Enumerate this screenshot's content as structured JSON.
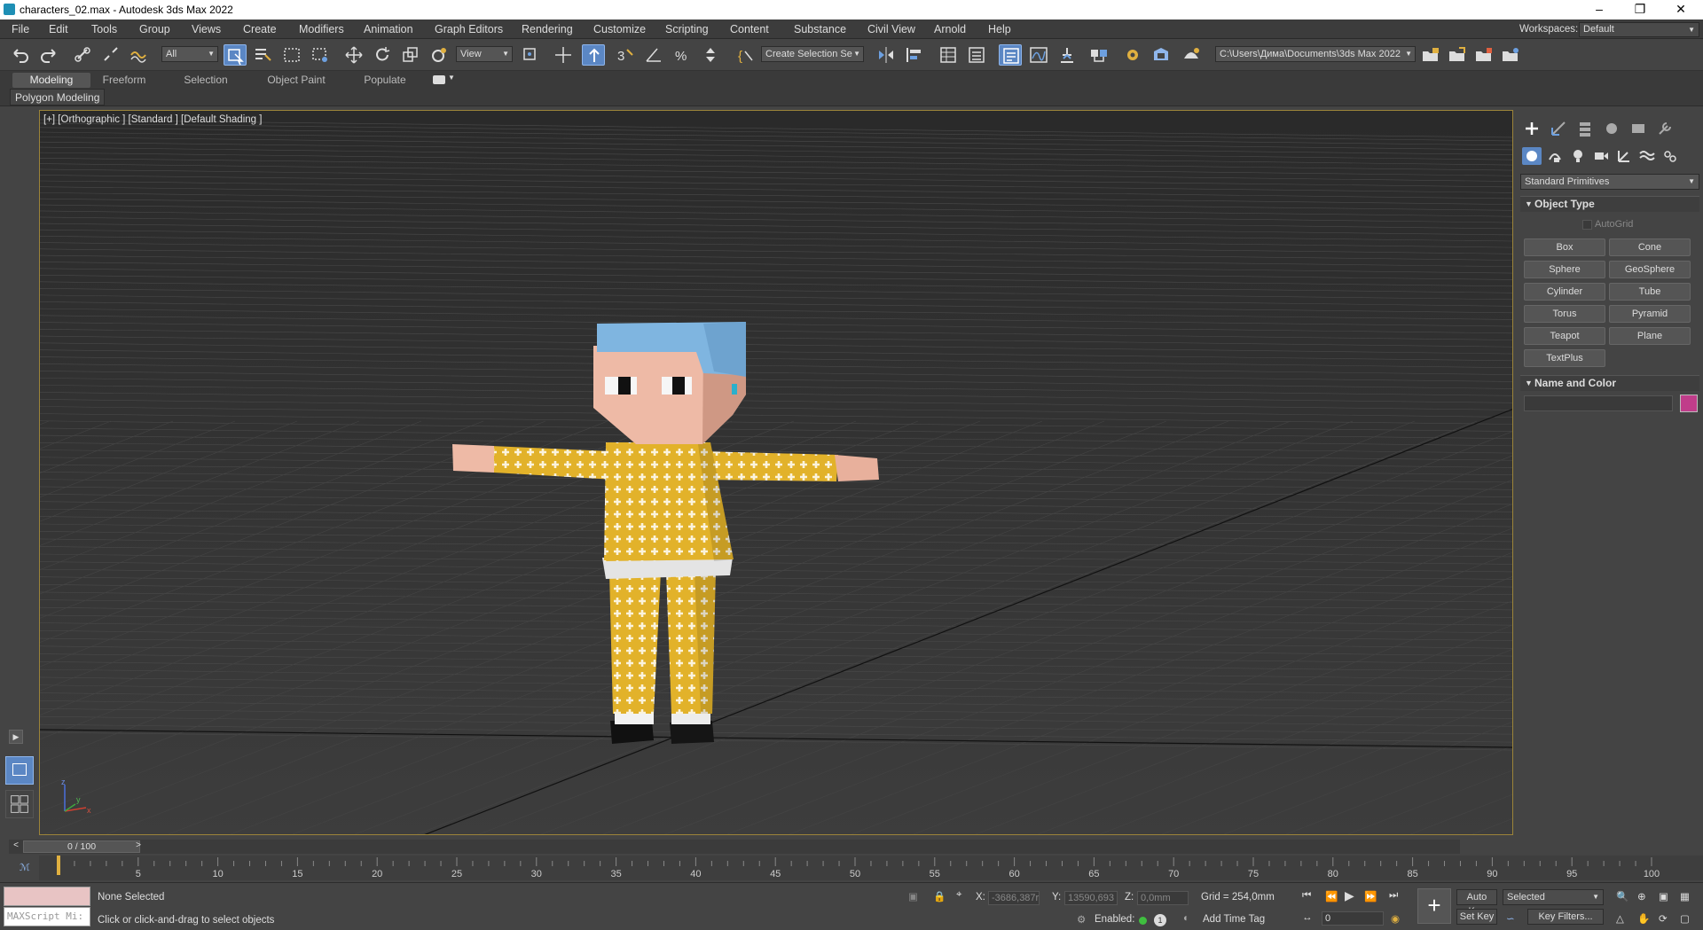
{
  "window": {
    "title": "characters_02.max - Autodesk 3ds Max 2022",
    "controls": [
      "minimize",
      "restore",
      "close"
    ]
  },
  "menubar": {
    "items": [
      "File",
      "Edit",
      "Tools",
      "Group",
      "Views",
      "Create",
      "Modifiers",
      "Animation",
      "Graph Editors",
      "Rendering",
      "Customize",
      "Scripting",
      "Content",
      "Substance",
      "Civil View",
      "Arnold",
      "Help"
    ],
    "workspace_label": "Workspaces:",
    "workspace_value": "Default"
  },
  "toolbar": {
    "filter_value": "All",
    "refcoord_value": "View",
    "selection_set_value": "Create Selection Se",
    "project_path": "C:\\Users\\Дима\\Documents\\3ds Max 2022"
  },
  "ribbon": {
    "tabs": [
      "Modeling",
      "Freeform",
      "Selection",
      "Object Paint",
      "Populate"
    ],
    "active_tab": "Modeling",
    "panel_label": "Polygon Modeling"
  },
  "viewport": {
    "label": "[+] [Orthographic ] [Standard ] [Default Shading ]",
    "axis_labels": {
      "x": "x",
      "y": "y",
      "z": "z"
    }
  },
  "command_panel": {
    "category": "Standard Primitives",
    "object_type_title": "Object Type",
    "autogrid_label": "AutoGrid",
    "buttons": [
      "Box",
      "Cone",
      "Sphere",
      "GeoSphere",
      "Cylinder",
      "Tube",
      "Torus",
      "Pyramid",
      "Teapot",
      "Plane",
      "TextPlus"
    ],
    "name_color_title": "Name and Color",
    "object_color": "#c03d8a"
  },
  "timeline": {
    "frame_display": "0 / 100",
    "ticks": [
      "5",
      "10",
      "15",
      "20",
      "25",
      "30",
      "35",
      "40",
      "45",
      "50",
      "55",
      "60",
      "65",
      "70",
      "75",
      "80",
      "85",
      "90",
      "95",
      "100"
    ]
  },
  "status": {
    "maxscript_placeholder": "MAXScript Mi:",
    "selection_text": "None Selected",
    "prompt_text": "Click or click-and-drag to select objects",
    "x_label": "X:",
    "x_value": "-3686,387r",
    "y_label": "Y:",
    "y_value": "13590,693",
    "z_label": "Z:",
    "z_value": "0,0mm",
    "grid_text": "Grid = 254,0mm",
    "enabled_label": "Enabled:",
    "add_time_tag": "Add Time Tag",
    "auto_key": "Auto Key",
    "set_key": "Set Key",
    "key_mode": "Selected",
    "key_filters": "Key Filters...",
    "frame_value": "0"
  },
  "colors": {
    "accent": "#5b87c4",
    "viewport_border": "#9c8439",
    "shirt": "#e2b22a",
    "skin": "#eebaa6",
    "hair": "#7fb5e0"
  }
}
